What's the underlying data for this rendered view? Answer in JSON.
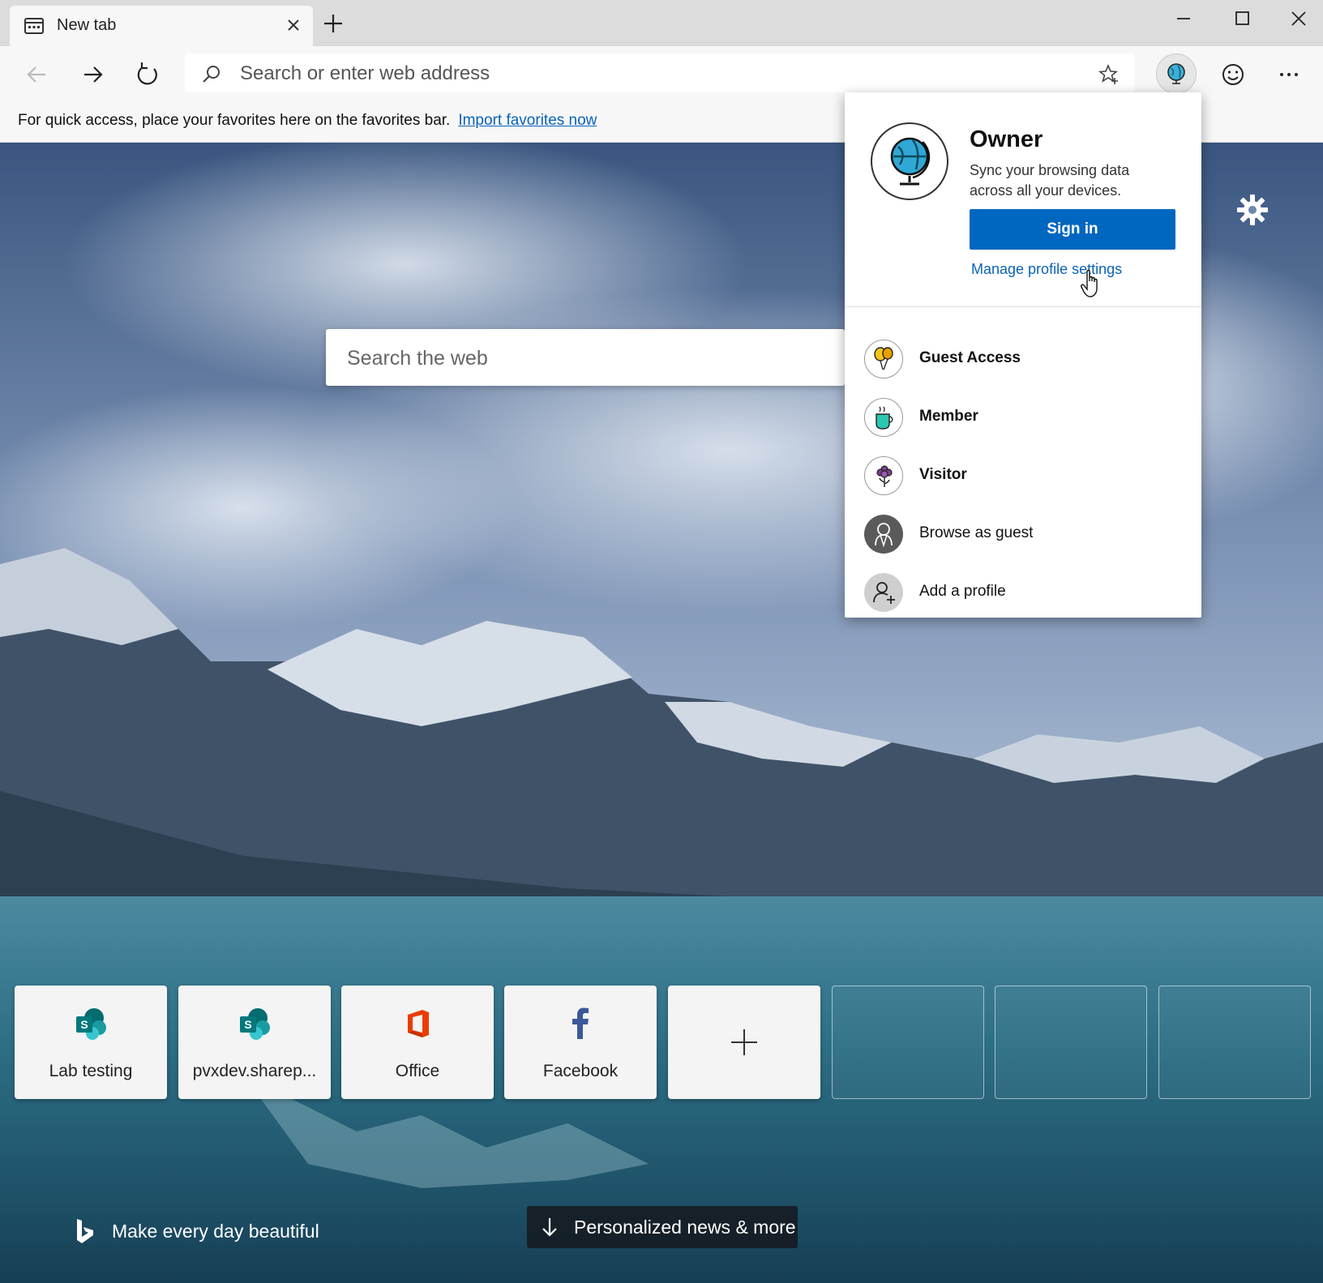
{
  "browser": {
    "tab": {
      "title": "New tab",
      "icon": "newtab-page-icon"
    },
    "address": {
      "placeholder": "Search or enter web address"
    },
    "favorites_bar": {
      "message": "For quick access, place your favorites here on the favorites bar.",
      "link": "Import favorites now"
    }
  },
  "newtab": {
    "search_placeholder": "Search the web",
    "quick_links": [
      {
        "label": "Lab testing",
        "icon": "sharepoint-icon"
      },
      {
        "label": "pvxdev.sharep...",
        "icon": "sharepoint-icon"
      },
      {
        "label": "Office",
        "icon": "office-icon"
      },
      {
        "label": "Facebook",
        "icon": "facebook-icon"
      }
    ],
    "bing_tagline": "Make every day beautiful",
    "news_button": "Personalized news & more"
  },
  "profile_flyout": {
    "owner": {
      "name": "Owner",
      "sync_text": "Sync your browsing data across all your devices.",
      "sign_in": "Sign in",
      "manage_link": "Manage profile settings"
    },
    "profiles": [
      {
        "label": "Guest Access",
        "icon": "balloons-icon",
        "bold": true
      },
      {
        "label": "Member",
        "icon": "coffee-cup-icon",
        "bold": true
      },
      {
        "label": "Visitor",
        "icon": "flower-icon",
        "bold": true
      },
      {
        "label": "Browse as guest",
        "icon": "guest-person-icon",
        "bold": false
      },
      {
        "label": "Add a profile",
        "icon": "add-person-icon",
        "bold": false
      }
    ]
  },
  "colors": {
    "accent": "#0067c0",
    "link": "#0b63b8"
  }
}
